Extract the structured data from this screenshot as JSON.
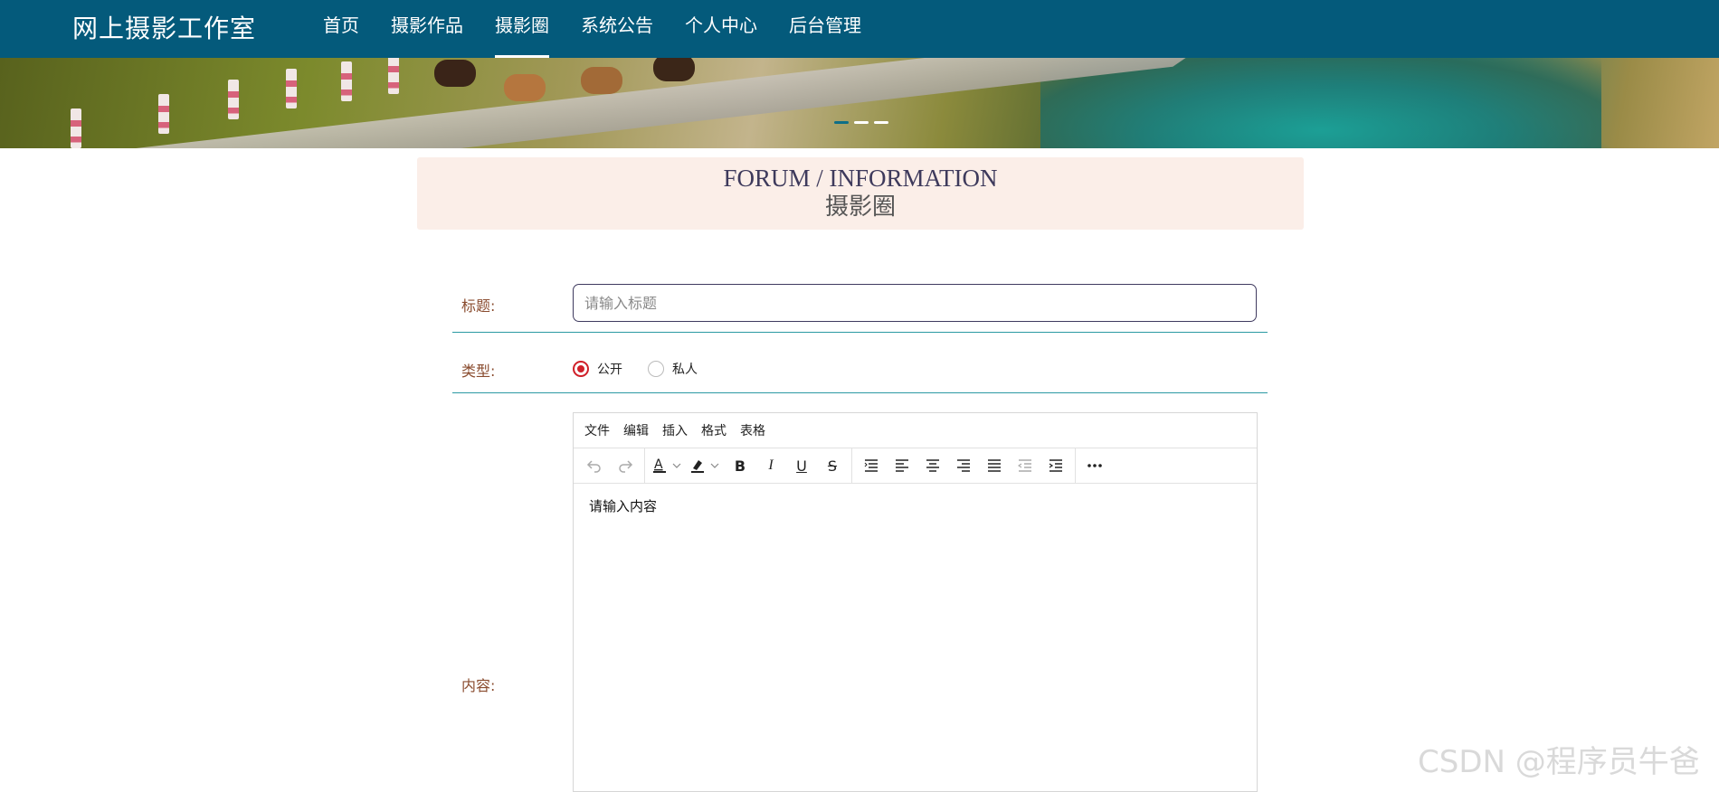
{
  "header": {
    "brand": "网上摄影工作室",
    "nav": [
      "首页",
      "摄影作品",
      "摄影圈",
      "系统公告",
      "个人中心",
      "后台管理"
    ],
    "active_index": 2,
    "bg_color": "#045a7b"
  },
  "banner": {
    "slide_count": 3,
    "active_slide": 0
  },
  "title_box": {
    "en": "FORUM / INFORMATION",
    "cn": "摄影圈",
    "bg_color": "#fbeee8"
  },
  "form": {
    "title_label": "标题:",
    "title_placeholder": "请输入标题",
    "title_value": "",
    "type_label": "类型:",
    "type_options": [
      "公开",
      "私人"
    ],
    "type_selected": "公开",
    "content_label": "内容:"
  },
  "editor": {
    "menus": [
      "文件",
      "编辑",
      "插入",
      "格式",
      "表格"
    ],
    "toolbar_icons": [
      "undo-icon",
      "redo-icon",
      "font-color-icon",
      "background-color-icon",
      "bold-icon",
      "italic-icon",
      "underline-icon",
      "strikethrough-icon",
      "line-height-icon",
      "align-left-icon",
      "align-center-icon",
      "align-right-icon",
      "align-justify-icon",
      "outdent-icon",
      "indent-icon",
      "more-icon"
    ],
    "placeholder": "请输入内容"
  },
  "watermark": "CSDN @程序员牛爸"
}
